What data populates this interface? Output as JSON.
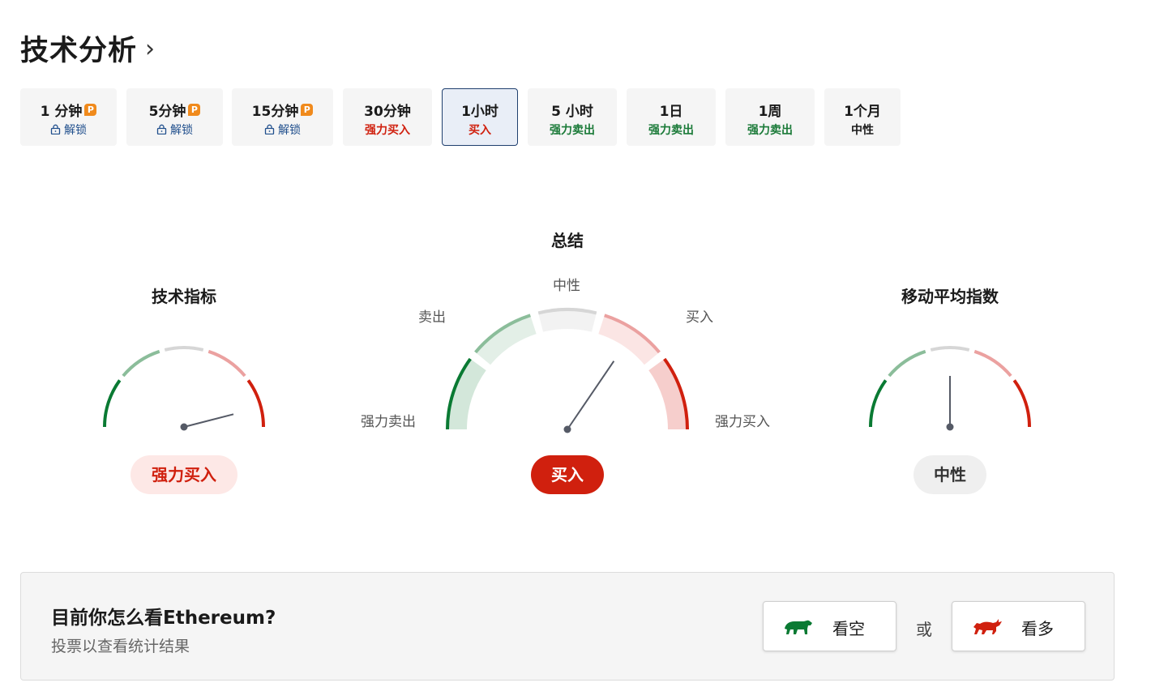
{
  "header": {
    "title": "技术分析"
  },
  "timeframes": [
    {
      "label": "1 分钟",
      "sub": "解锁",
      "locked": true,
      "pro": true,
      "pro_badge": "P",
      "active": false
    },
    {
      "label": "5分钟",
      "sub": "解锁",
      "locked": true,
      "pro": true,
      "pro_badge": "P",
      "active": false
    },
    {
      "label": "15分钟",
      "sub": "解锁",
      "locked": true,
      "pro": true,
      "pro_badge": "P",
      "active": false
    },
    {
      "label": "30分钟",
      "sub": "强力买入",
      "locked": false,
      "active": false
    },
    {
      "label": "1小时",
      "sub": "买入",
      "locked": false,
      "active": true
    },
    {
      "label": "5 小时",
      "sub": "强力卖出",
      "locked": false,
      "active": false
    },
    {
      "label": "1日",
      "sub": "强力卖出",
      "locked": false,
      "active": false
    },
    {
      "label": "1周",
      "sub": "强力卖出",
      "locked": false,
      "active": false
    },
    {
      "label": "1个月",
      "sub": "中性",
      "locked": false,
      "active": false
    }
  ],
  "gauges": {
    "indicators": {
      "title": "技术指标",
      "result": "强力买入",
      "needle": 0.92
    },
    "summary": {
      "title": "总结",
      "result": "买入",
      "needle": 0.69,
      "labels": {
        "strong_sell": "强力卖出",
        "sell": "卖出",
        "neutral": "中性",
        "buy": "买入",
        "strong_buy": "强力买入"
      }
    },
    "moving_averages": {
      "title": "移动平均指数",
      "result": "中性",
      "needle": 0.5
    }
  },
  "vote": {
    "question": "目前你怎么看Ethereum?",
    "subtitle": "投票以查看统计结果",
    "bearish": {
      "label": "看空",
      "icon": "bear-icon"
    },
    "or": "或",
    "bullish": {
      "label": "看多",
      "icon": "bull-icon"
    }
  },
  "colors": {
    "strong_sell": "#0a7a33",
    "sell": "#8bbd9a",
    "neutral": "#d6d6d6",
    "buy": "#eba1a0",
    "strong_buy": "#d0200e",
    "sell_text": "#1a7a38",
    "buy_text": "#d0200e",
    "active_border": "#1f3f6e",
    "pro": "#f08a1c"
  }
}
